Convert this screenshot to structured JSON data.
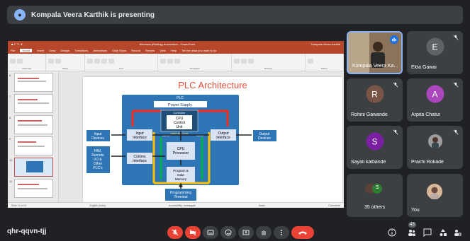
{
  "banner": {
    "text": "Kompala Veera Karthik is presenting"
  },
  "ppt": {
    "window_title": "Windows (Binding) Automation - PowerPoint",
    "account": "Kompala Veera Karthik",
    "menu": [
      "File",
      "Home",
      "Insert",
      "Draw",
      "Design",
      "Transitions",
      "Animations",
      "Slide Show",
      "Record",
      "Review",
      "View",
      "Help"
    ],
    "tell_me": "Tell me what you want to do",
    "ribbon_groups": [
      "Clipboard",
      "Slides",
      "Font",
      "Paragraph",
      "Drawing",
      "Editing"
    ],
    "status_left": "Slide 10 of 22",
    "status_lang": "English (India)",
    "status_access": "Accessibility: Investigate",
    "status_notes": "Notes",
    "status_comments": "Comments",
    "slide_numbers": [
      "6",
      "7",
      "8",
      "9",
      "10",
      "11"
    ]
  },
  "slide": {
    "title": "PLC Architecture",
    "plc": "PLC",
    "power_supply": "Power Supply",
    "power": "POWER",
    "controller": "Controller",
    "cpu_control_unit": [
      "CPU",
      "Control",
      "Unit"
    ],
    "address_code": "Address/ Code",
    "data": "DATA",
    "input_interface": [
      "Input",
      "Interface"
    ],
    "output_interface": [
      "Output",
      "Interface"
    ],
    "cpu_processor": [
      "CPU",
      "Processor"
    ],
    "comms_interface": [
      "Comms",
      "Interface"
    ],
    "program_data_memory": [
      "Program &",
      "Data",
      "Memory"
    ],
    "input_devices": [
      "Input",
      "Devices"
    ],
    "output_devices": [
      "Output",
      "Devices"
    ],
    "hmi": [
      "HMI,",
      "Remote",
      "I/O &",
      "Other",
      "PLC's"
    ],
    "programming_terminal": [
      "Programming",
      "Terminal"
    ]
  },
  "participants": [
    {
      "name": "Kompala Veera Ka...",
      "kind": "video"
    },
    {
      "name": "Ekta Gawai",
      "initial": "E",
      "color": "#5f6368"
    },
    {
      "name": "Rohini Gawande",
      "initial": "R",
      "color": "#795548"
    },
    {
      "name": "Arpita Chatur",
      "initial": "A",
      "color": "#ab47bc"
    },
    {
      "name": "Sayali kalbande",
      "initial": "S",
      "color": "#7b1fa2"
    },
    {
      "name": "Prachi Rokade",
      "kind": "photo"
    },
    {
      "name": "35 others",
      "kind": "others",
      "initial": "S"
    },
    {
      "name": "You",
      "kind": "photo"
    }
  ],
  "meeting": {
    "code": "qhr-qqvn-tjj",
    "participant_count": "43"
  },
  "colors": {
    "background": "#202124",
    "tile": "#3c4043",
    "red": "#ea4335",
    "ppt_red": "#b7472a",
    "plc_blue": "#2e75b6"
  }
}
